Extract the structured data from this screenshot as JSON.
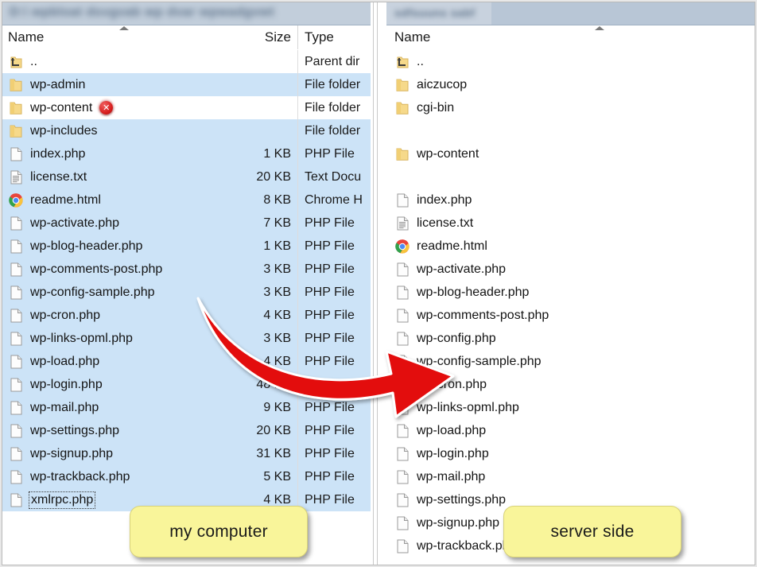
{
  "window": {
    "left_panel": {
      "title_redacted": "D:\\ wpbloat dsvgvab wp dvar wpwadgvwt",
      "title_is_blurred": true,
      "columns": [
        "Name",
        "Size",
        "Type"
      ],
      "sort_column": "Name",
      "sort_direction": "ascending",
      "label": "my computer",
      "rows": [
        {
          "name": "..",
          "size": "",
          "type": "Parent dir",
          "icon": "parent-folder-icon",
          "selected": false
        },
        {
          "name": "wp-admin",
          "size": "",
          "type": "File folder",
          "icon": "folder-icon",
          "selected": true
        },
        {
          "name": "wp-content",
          "size": "",
          "type": "File folder",
          "icon": "folder-icon",
          "selected": false,
          "badge": "error-badge"
        },
        {
          "name": "wp-includes",
          "size": "",
          "type": "File folder",
          "icon": "folder-icon",
          "selected": true
        },
        {
          "name": "index.php",
          "size": "1 KB",
          "type": "PHP File",
          "icon": "file-icon",
          "selected": true
        },
        {
          "name": "license.txt",
          "size": "20 KB",
          "type": "Text Docu",
          "icon": "text-file-icon",
          "selected": true
        },
        {
          "name": "readme.html",
          "size": "8 KB",
          "type": "Chrome H",
          "icon": "chrome-icon",
          "selected": true
        },
        {
          "name": "wp-activate.php",
          "size": "7 KB",
          "type": "PHP File",
          "icon": "file-icon",
          "selected": true
        },
        {
          "name": "wp-blog-header.php",
          "size": "1 KB",
          "type": "PHP File",
          "icon": "file-icon",
          "selected": true
        },
        {
          "name": "wp-comments-post.php",
          "size": "3 KB",
          "type": "PHP File",
          "icon": "file-icon",
          "selected": true
        },
        {
          "name": "wp-config-sample.php",
          "size": "3 KB",
          "type": "PHP File",
          "icon": "file-icon",
          "selected": true
        },
        {
          "name": "wp-cron.php",
          "size": "4 KB",
          "type": "PHP File",
          "icon": "file-icon",
          "selected": true
        },
        {
          "name": "wp-links-opml.php",
          "size": "3 KB",
          "type": "PHP File",
          "icon": "file-icon",
          "selected": true
        },
        {
          "name": "wp-load.php",
          "size": "4 KB",
          "type": "PHP File",
          "icon": "file-icon",
          "selected": true
        },
        {
          "name": "wp-login.php",
          "size": "48 KB",
          "type": "PHP File",
          "icon": "file-icon",
          "selected": true
        },
        {
          "name": "wp-mail.php",
          "size": "9 KB",
          "type": "PHP File",
          "icon": "file-icon",
          "selected": true
        },
        {
          "name": "wp-settings.php",
          "size": "20 KB",
          "type": "PHP File",
          "icon": "file-icon",
          "selected": true
        },
        {
          "name": "wp-signup.php",
          "size": "31 KB",
          "type": "PHP File",
          "icon": "file-icon",
          "selected": true
        },
        {
          "name": "wp-trackback.php",
          "size": "5 KB",
          "type": "PHP File",
          "icon": "file-icon",
          "selected": true
        },
        {
          "name": "xmlrpc.php",
          "size": "4 KB",
          "type": "PHP File",
          "icon": "file-icon",
          "selected": true,
          "focused": true
        }
      ]
    },
    "right_panel": {
      "title_redacted": "sdfsuuns sabf",
      "title_is_blurred": true,
      "columns": [
        "Name"
      ],
      "sort_column": "Name",
      "sort_direction": "ascending",
      "label": "server side",
      "rows": [
        {
          "name": "..",
          "icon": "parent-folder-icon",
          "selected": false
        },
        {
          "name": "aiczucop",
          "icon": "folder-icon",
          "selected": false
        },
        {
          "name": "cgi-bin",
          "icon": "folder-icon",
          "selected": false
        },
        {
          "name": "",
          "icon": "none",
          "selected": false,
          "blank": true
        },
        {
          "name": "wp-content",
          "icon": "folder-icon",
          "selected": false
        },
        {
          "name": "",
          "icon": "none",
          "selected": false,
          "blank": true
        },
        {
          "name": "index.php",
          "icon": "file-icon",
          "selected": false
        },
        {
          "name": "license.txt",
          "icon": "text-file-icon",
          "selected": false
        },
        {
          "name": "readme.html",
          "icon": "chrome-icon",
          "selected": false
        },
        {
          "name": "wp-activate.php",
          "icon": "file-icon",
          "selected": false
        },
        {
          "name": "wp-blog-header.php",
          "icon": "file-icon",
          "selected": false
        },
        {
          "name": "wp-comments-post.php",
          "icon": "file-icon",
          "selected": false
        },
        {
          "name": "wp-config.php",
          "icon": "file-icon",
          "selected": false
        },
        {
          "name": "wp-config-sample.php",
          "icon": "file-icon",
          "selected": false
        },
        {
          "name": "wp-cron.php",
          "icon": "file-icon",
          "selected": false
        },
        {
          "name": "wp-links-opml.php",
          "icon": "file-icon",
          "selected": false
        },
        {
          "name": "wp-load.php",
          "icon": "file-icon",
          "selected": false
        },
        {
          "name": "wp-login.php",
          "icon": "file-icon",
          "selected": false
        },
        {
          "name": "wp-mail.php",
          "icon": "file-icon",
          "selected": false
        },
        {
          "name": "wp-settings.php",
          "icon": "file-icon",
          "selected": false
        },
        {
          "name": "wp-signup.php",
          "icon": "file-icon",
          "selected": false
        },
        {
          "name": "wp-trackback.php",
          "icon": "file-icon",
          "selected": false
        }
      ]
    }
  },
  "annotations": {
    "arrow": {
      "name": "red-curved-arrow",
      "color": "#e31010",
      "direction": "left-to-right-upward"
    },
    "error_badge_glyph": "✕",
    "callout_left": "my computer",
    "callout_right": "server side"
  },
  "colors": {
    "selection": "#cce3f7",
    "titlebar": "#b8c6d6",
    "callout_bg": "#f9f59a",
    "arrow_red": "#e31010",
    "error_red": "#d81f1f"
  }
}
